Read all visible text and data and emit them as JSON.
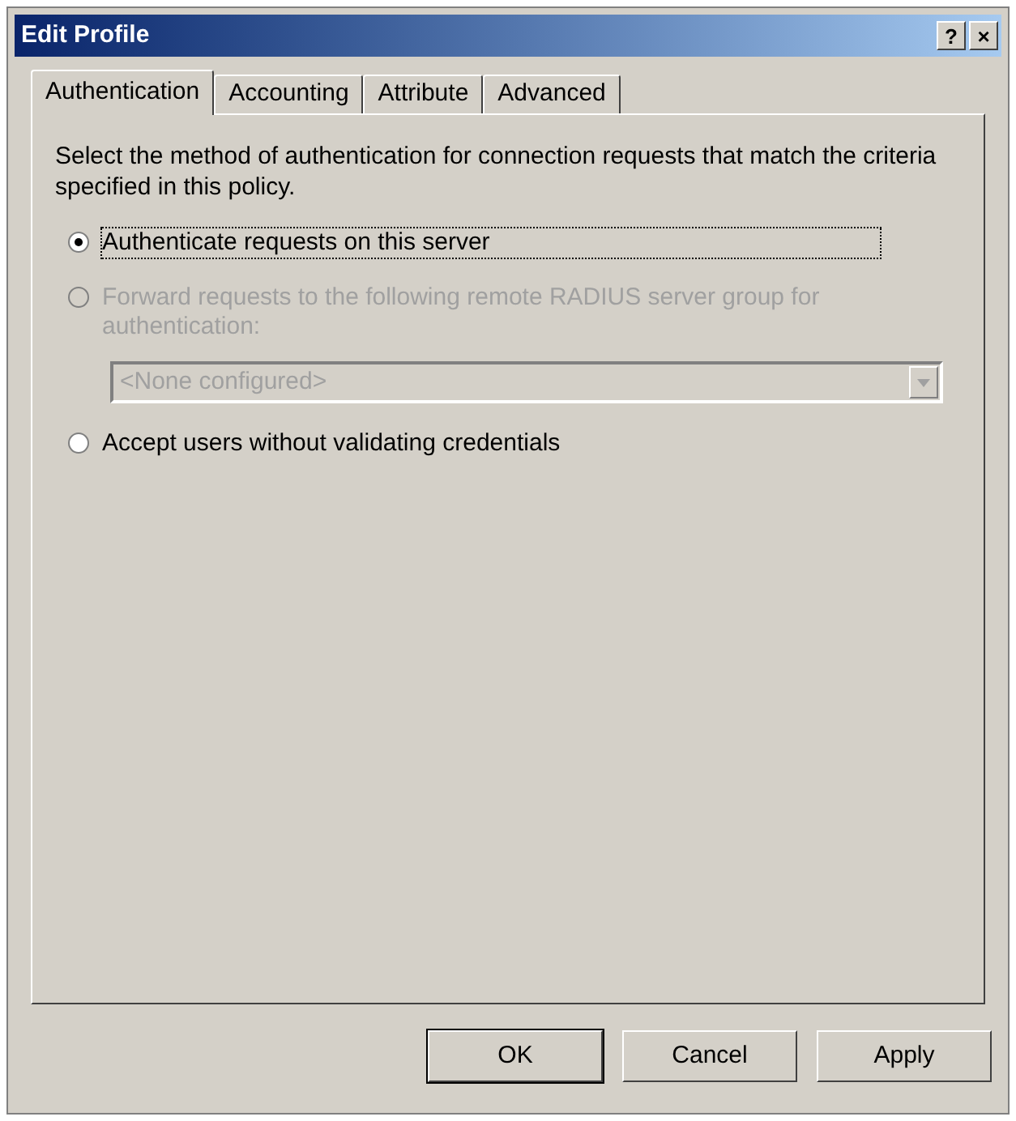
{
  "window": {
    "title": "Edit Profile",
    "controls": [
      "?",
      "×"
    ]
  },
  "tabs": [
    {
      "label": "Authentication",
      "selected": true
    },
    {
      "label": "Accounting",
      "selected": false
    },
    {
      "label": "Attribute",
      "selected": false
    },
    {
      "label": "Advanced",
      "selected": false
    }
  ],
  "description": "Select the method of authentication for connection requests that match the criteria specified in this policy.",
  "options": [
    {
      "label": "Authenticate requests on this server",
      "selected": true,
      "disabled": false
    },
    {
      "label": "Forward requests to the following remote RADIUS server group for authentication:",
      "selected": false,
      "disabled": true,
      "dropdown": {
        "value": "<None configured>",
        "disabled": true
      }
    },
    {
      "label": "Accept users without validating credentials",
      "selected": false,
      "disabled": false
    }
  ],
  "buttons": [
    "OK",
    "Cancel",
    "Apply"
  ]
}
